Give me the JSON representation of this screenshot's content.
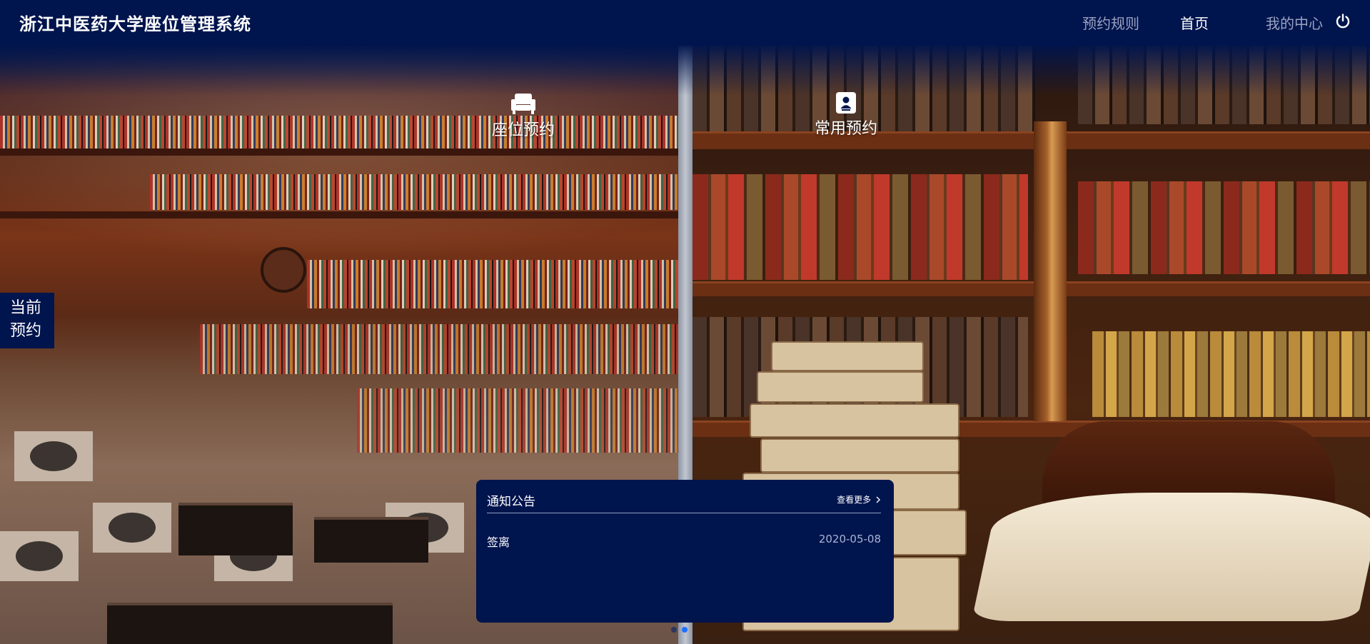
{
  "header": {
    "brand": "浙江中医药大学座位管理系统",
    "nav": [
      {
        "label": "预约规则",
        "active": false
      },
      {
        "label": "首页",
        "active": true
      },
      {
        "label": "我的中心",
        "active": false
      }
    ],
    "power_icon": "power-icon"
  },
  "features": [
    {
      "label": "座位预约",
      "icon": "armchair-icon"
    },
    {
      "label": "常用预约",
      "icon": "contact-book-icon"
    }
  ],
  "side_badge": {
    "line1": "当前",
    "line2": "预约"
  },
  "notice": {
    "title": "通知公告",
    "more": "查看更多",
    "more_icon": "chevron-right-icon",
    "items": [
      {
        "title": "签离",
        "date": "2020-05-08"
      }
    ]
  },
  "carousel": {
    "count": 2,
    "active_index": 1
  },
  "colors": {
    "navy": "#00144d",
    "active_dot": "#1e6fff",
    "inactive_dot": "#2b3560"
  }
}
